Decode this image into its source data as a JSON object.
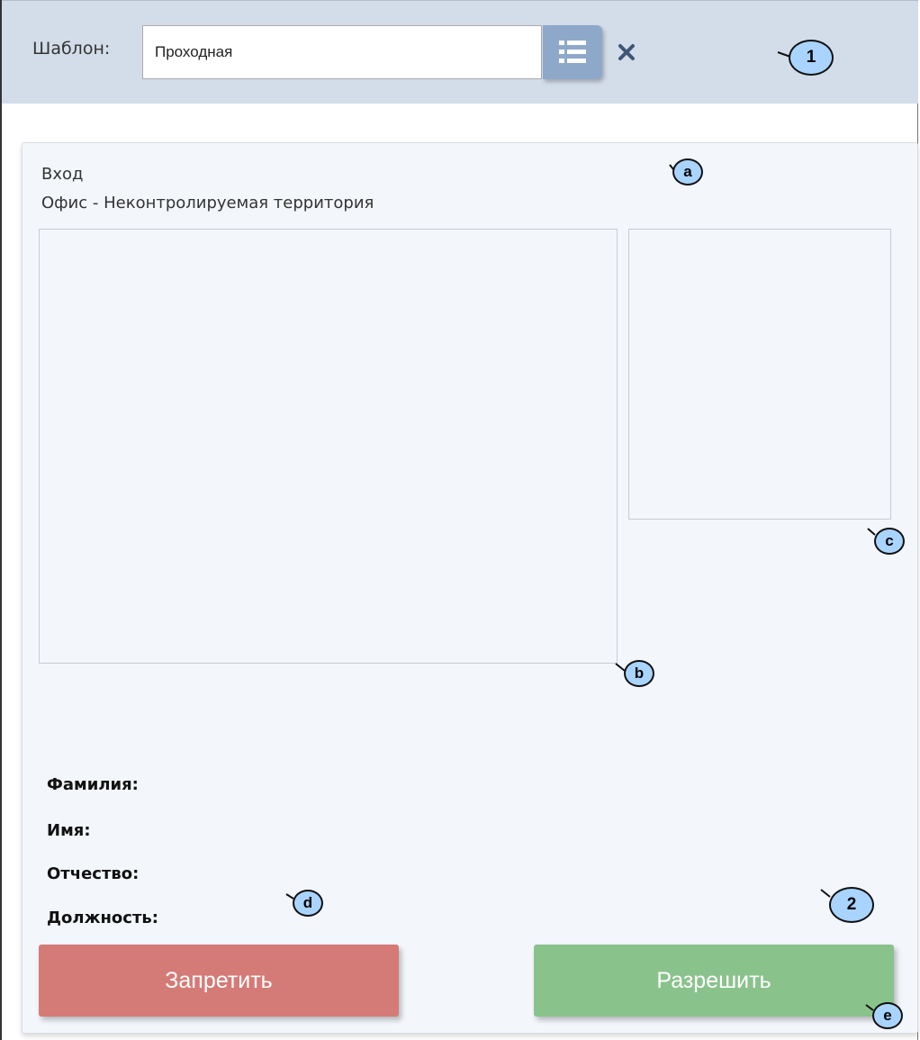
{
  "template": {
    "label": "Шаблон:",
    "value": "Проходная"
  },
  "event": {
    "direction": "Вход",
    "zone": "Офис - Неконтролируемая территория"
  },
  "fields": {
    "last_name": "Фамилия:",
    "first_name": "Имя:",
    "patronymic": "Отчество:",
    "position": "Должность:"
  },
  "buttons": {
    "deny": "Запретить",
    "allow": "Разрешить"
  },
  "callouts": {
    "c1": "1",
    "c2": "2",
    "a": "a",
    "b": "b",
    "c": "c",
    "d": "d",
    "e": "e"
  },
  "colors": {
    "topbar": "#d3dde9",
    "deny": "#d47b77",
    "allow": "#8ac28c",
    "callout": "#a8d4ff",
    "list_button": "#8ea8ca"
  },
  "icons": {
    "list": "list-icon",
    "clear": "close-icon"
  }
}
